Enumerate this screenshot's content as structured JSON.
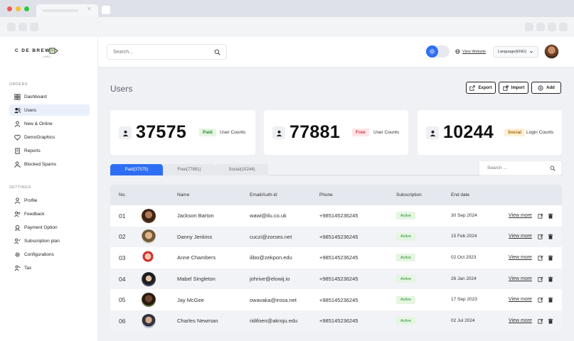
{
  "brand": {
    "name": "C  DE BREW",
    "sub": "LABS"
  },
  "sidebar": {
    "section_orders": "ORDERS",
    "orders": [
      {
        "label": "Dashboard",
        "icon": "dashboard-icon"
      },
      {
        "label": "Users",
        "icon": "users-icon",
        "active": true
      },
      {
        "label": "New & Online",
        "icon": "person-icon"
      },
      {
        "label": "DemoGraphics",
        "icon": "heart-icon"
      },
      {
        "label": "Reports",
        "icon": "report-icon"
      },
      {
        "label": "Blocked Spams",
        "icon": "blocked-icon"
      }
    ],
    "section_settings": "SETTINGS",
    "settings": [
      {
        "label": "Profile",
        "icon": "profile-icon"
      },
      {
        "label": "Feedback",
        "icon": "feedback-icon"
      },
      {
        "label": "Payment Option",
        "icon": "payment-icon"
      },
      {
        "label": "Subscription plan",
        "icon": "subscription-icon"
      },
      {
        "label": "Configurations",
        "icon": "gear-icon"
      },
      {
        "label": "Tax",
        "icon": "tax-icon"
      }
    ]
  },
  "header": {
    "search_placeholder": "Search...",
    "view_website": "View Website",
    "language": "Language(ENG)"
  },
  "page": {
    "title": "Users",
    "actions": {
      "export": "Export",
      "import": "Import",
      "add": "Add"
    }
  },
  "stats": [
    {
      "value": "37575",
      "badge": "Paid",
      "label": "User Counts",
      "badge_bg": "#e4f6e1",
      "badge_color": "#2f8a2f"
    },
    {
      "value": "77881",
      "badge": "Free",
      "label": "User Counts",
      "badge_bg": "#fde4e6",
      "badge_color": "#d23b4a"
    },
    {
      "value": "10244",
      "badge": "Social",
      "label": "Login Counts",
      "badge_bg": "#fdf0d8",
      "badge_color": "#a46a00"
    }
  ],
  "tabs": [
    {
      "label": "Paid(37575)",
      "active": true
    },
    {
      "label": "Free(77881)"
    },
    {
      "label": "Social(10244)"
    }
  ],
  "table_search_placeholder": "Search ...",
  "table": {
    "columns": [
      "No.",
      "Name",
      "Email/Auth-id",
      "Phone",
      "Subscription",
      "End date"
    ],
    "view_more": "View more",
    "rows": [
      {
        "no": "01",
        "name": "Jackson Barton",
        "email": "wawi@ilu.co.uk",
        "phone": "+985145236245",
        "subscription": "Active",
        "end_date": "30 Sep 2024"
      },
      {
        "no": "02",
        "name": "Danny Jenkins",
        "email": "cuczi@zorses.net",
        "phone": "+985145236245",
        "subscription": "Active",
        "end_date": "15 Feb 2024"
      },
      {
        "no": "03",
        "name": "Anne Chambers",
        "email": "ilibo@zekpon.edu",
        "phone": "+985145236245",
        "subscription": "Active",
        "end_date": "02 Oct 2023"
      },
      {
        "no": "04",
        "name": "Mabel Singleton",
        "email": "johrive@elowij.io",
        "phone": "+985145236245",
        "subscription": "Active",
        "end_date": "26 Jan 2024"
      },
      {
        "no": "05",
        "name": "Jay McGee",
        "email": "owavaka@irosa.net",
        "phone": "+985145236245",
        "subscription": "Active",
        "end_date": "17 Sep 2023"
      },
      {
        "no": "06",
        "name": "Charles Newman",
        "email": "ridifoen@akroju.edu",
        "phone": "+985145236245",
        "subscription": "Active",
        "end_date": "02 Jul 2024"
      }
    ]
  },
  "colors": {
    "accent": "#2e6ef2"
  }
}
